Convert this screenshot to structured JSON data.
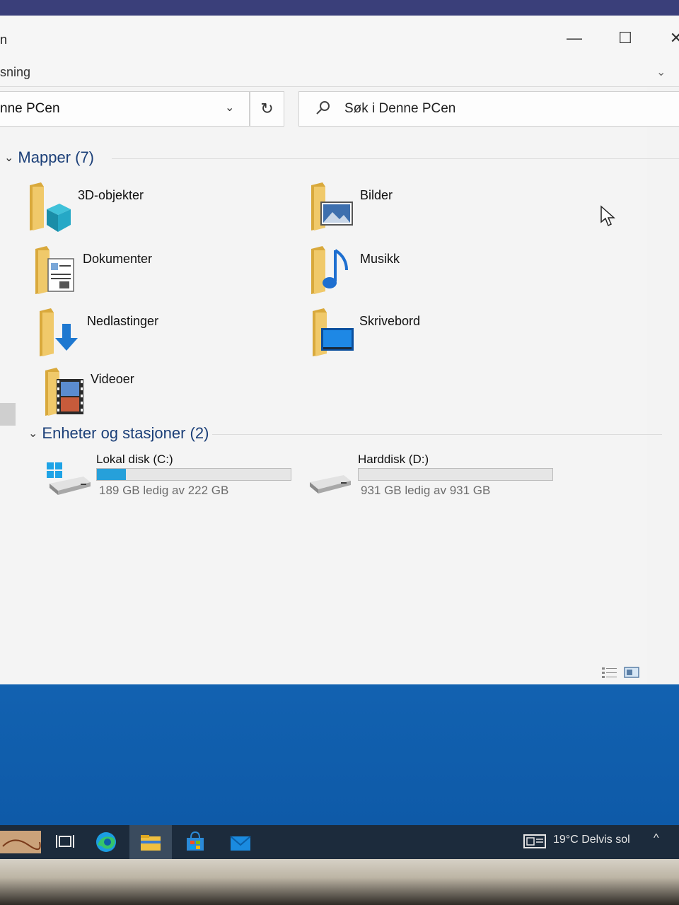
{
  "window": {
    "title_fragment": "n",
    "ribbon_tab_fragment": "sning",
    "controls": {
      "minimize": "—",
      "maximize": "☐",
      "close": "✕"
    }
  },
  "address_bar": {
    "text": "nne PCen"
  },
  "search": {
    "placeholder": "Søk i Denne PCen"
  },
  "folders_group": {
    "header": "Mapper (7)",
    "items": [
      {
        "label": "3D-objekter",
        "icon": "3d-objects-folder-icon"
      },
      {
        "label": "Bilder",
        "icon": "pictures-folder-icon"
      },
      {
        "label": "Dokumenter",
        "icon": "documents-folder-icon"
      },
      {
        "label": "Musikk",
        "icon": "music-folder-icon"
      },
      {
        "label": "Nedlastinger",
        "icon": "downloads-folder-icon"
      },
      {
        "label": "Skrivebord",
        "icon": "desktop-folder-icon"
      },
      {
        "label": "Videoer",
        "icon": "videos-folder-icon"
      }
    ]
  },
  "devices_group": {
    "header": "Enheter og stasjoner (2)",
    "drives": [
      {
        "name": "Lokal disk (C:)",
        "free_text": "189 GB ledig av 222 GB",
        "used_fraction": 0.15,
        "icon": "windows-drive-icon"
      },
      {
        "name": "Harddisk (D:)",
        "free_text": "931 GB ledig av 931 GB",
        "used_fraction": 0.0,
        "icon": "hard-drive-icon"
      }
    ]
  },
  "taskbar": {
    "weather": "19°C  Delvis sol",
    "caret": "^"
  },
  "colors": {
    "accent": "#26a0da",
    "group_header": "#1b3f78",
    "folder": "#e8c067",
    "taskbar": "#1c2b3c",
    "desktop": "#1a70c0"
  }
}
